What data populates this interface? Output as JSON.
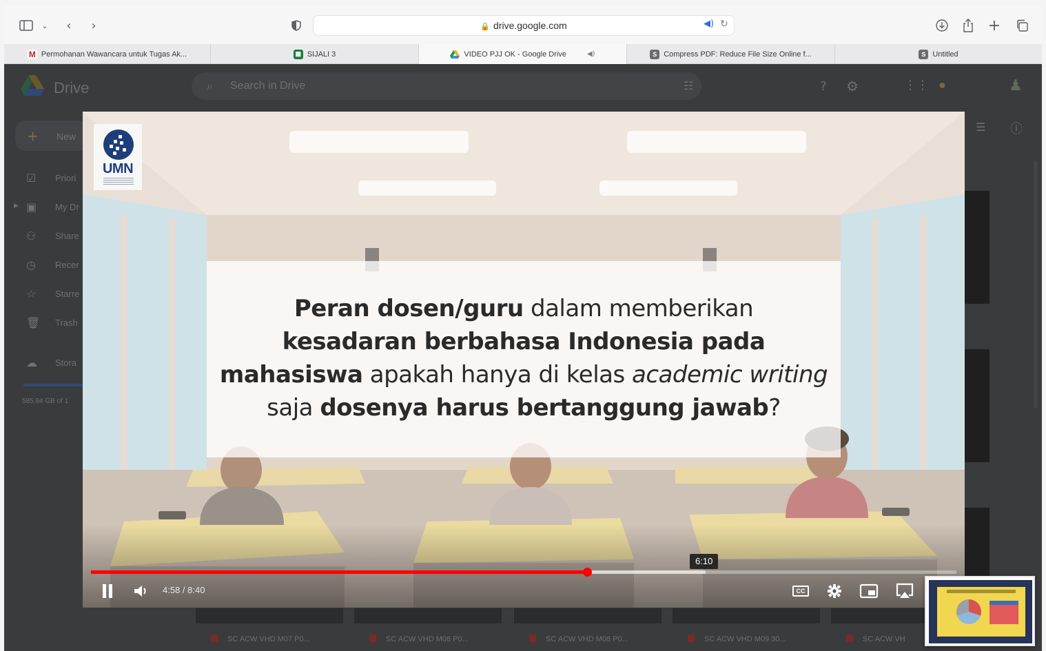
{
  "browser": {
    "url": "drive.google.com",
    "tabs": [
      {
        "label": "Permohanan Wawancara untuk Tugas Ak...",
        "icon": "gmail-icon",
        "color": "#c5221f",
        "active": false
      },
      {
        "label": "SIJALI 3",
        "icon": "sheets-icon",
        "color": "#188038",
        "active": false
      },
      {
        "label": "VIDEO PJJ OK - Google Drive",
        "icon": "drive-icon",
        "color": "#f4b400",
        "active": true
      },
      {
        "label": "Compress PDF: Reduce File Size Online f...",
        "icon": "smallpdf-icon",
        "color": "#6b6b6f",
        "active": false
      },
      {
        "label": "Untitled",
        "icon": "smallpdf-icon",
        "color": "#6b6b6f",
        "active": false
      }
    ]
  },
  "drive": {
    "title": "Drive",
    "search_placeholder": "Search in Drive",
    "new_label": "New",
    "nav": [
      "Priori",
      "My Dr",
      "Share",
      "Recer",
      "Starre",
      "Trash",
      "Stora"
    ],
    "storage_text": "585.94 GB of 1",
    "files": [
      "SC ACW VHD M07 P0...",
      "SC ACW VHD M08 P0...",
      "SC ACW VHD M08 P0...",
      "SC ACW VHD M09 30...",
      "SC ACW VH"
    ]
  },
  "video": {
    "logo_text": "UMN",
    "caption": {
      "l1_bold": "Peran dosen/guru",
      "l1_rest": " dalam memberikan",
      "l2_bold": "kesadaran berbahasa Indonesia pada",
      "l3_bold": "mahasiswa",
      "l3_mid": " apakah hanya di kelas ",
      "l3_italic": "academic writing",
      "l4_start": "saja ",
      "l4_bold": "dosenya harus bertanggung jawab",
      "l4_end": "?"
    },
    "current_time": "4:58",
    "duration": "8:40",
    "time_display": "4:58 / 8:40",
    "progress_fraction": 0.573,
    "buffered_fraction": 0.71,
    "hover_time": "6:10",
    "hover_fraction": 0.711,
    "accent_color": "#ff0000"
  }
}
